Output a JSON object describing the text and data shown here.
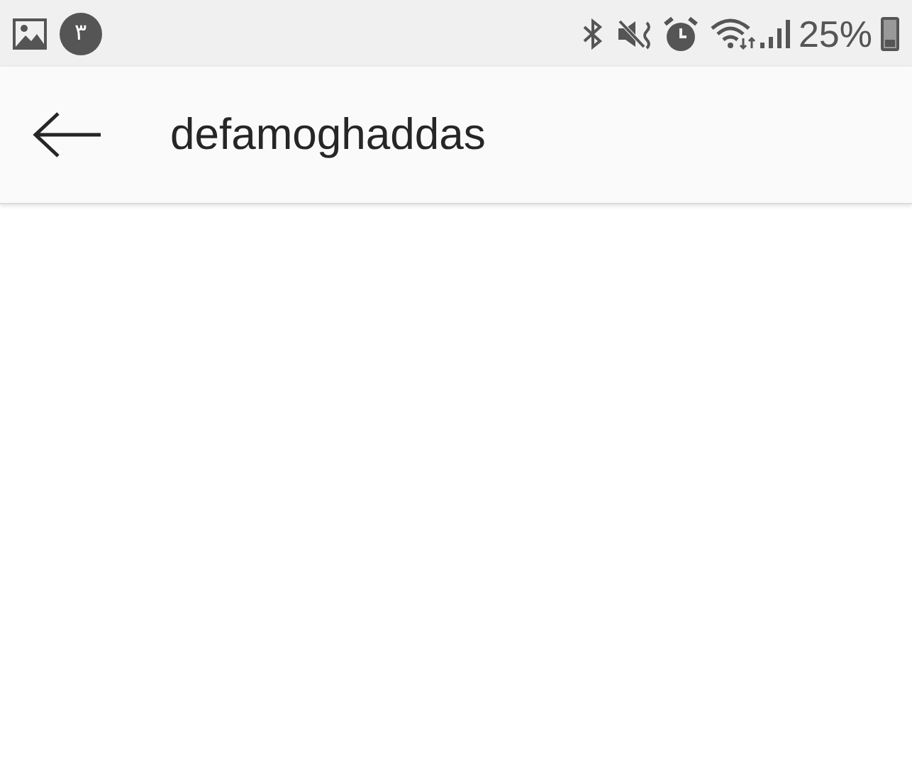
{
  "status_bar": {
    "notification_badge": "٣",
    "battery_percent": "25%"
  },
  "header": {
    "title": "defamoghaddas"
  }
}
